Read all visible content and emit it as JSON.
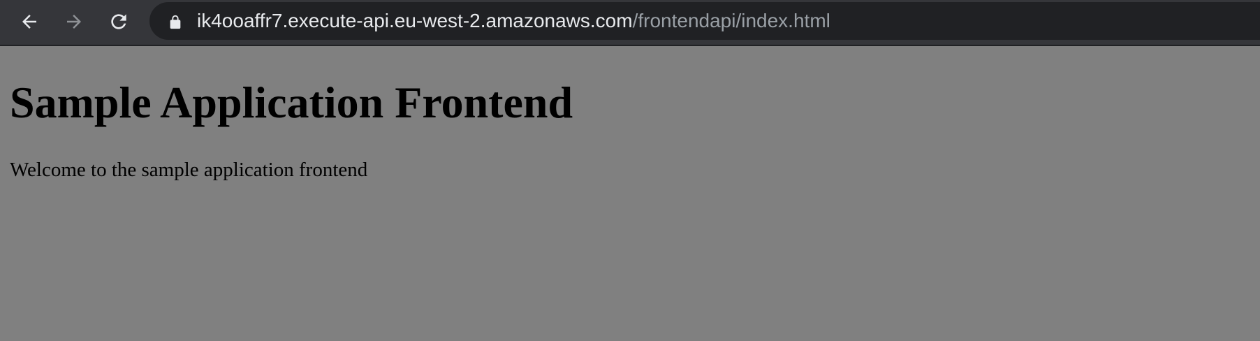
{
  "browser": {
    "url_host": "ik4ooaffr7.execute-api.eu-west-2.amazonaws.com",
    "url_path": "/frontendapi/index.html",
    "icons": {
      "back": "arrow-left-icon",
      "forward": "arrow-right-icon",
      "reload": "reload-icon",
      "secure": "lock-icon"
    }
  },
  "page": {
    "heading": "Sample Application Frontend",
    "welcome_text": "Welcome to the sample application frontend"
  },
  "colors": {
    "page_background": "#808080",
    "toolbar_background": "#35363a",
    "omnibox_background": "#202124",
    "url_host_color": "#e8eaed",
    "url_path_color": "#9aa0a6"
  }
}
